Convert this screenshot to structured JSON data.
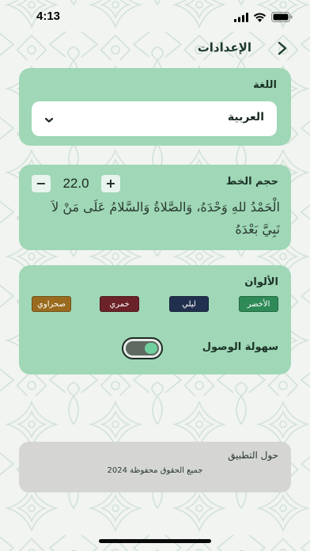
{
  "status_bar": {
    "time": "4:13"
  },
  "header": {
    "title": "الإعدادات"
  },
  "language": {
    "label": "اللغة",
    "selected": "العربية"
  },
  "font_size": {
    "label": "حجم الخط",
    "value": "22.0",
    "decrement": "−",
    "increment": "+",
    "sample": "الْحَمْدُ للهِ وَحْدَهُ، وَالصَّلاةُ وَالسَّلامُ عَلَى مَنْ لاَ نَبِيَّ بَعْدَهُ"
  },
  "colors": {
    "label": "الألوان",
    "themes": [
      {
        "name": "الأخضر",
        "color": "#2e8a57"
      },
      {
        "name": "ليلي",
        "color": "#22304f"
      },
      {
        "name": "خمري",
        "color": "#6b2228"
      },
      {
        "name": "صحراوي",
        "color": "#9a6b1f"
      }
    ]
  },
  "accessibility": {
    "label": "سهولة الوصول",
    "enabled": true
  },
  "about": {
    "title": "حول التطبيق",
    "copyright": "جميع الحقوق محفوظة 2024"
  },
  "theme_colors": {
    "card": "#9fd7b7",
    "about_card": "#d5d6d4",
    "background": "#f1f4f1",
    "pattern": "#d4e3d8"
  }
}
